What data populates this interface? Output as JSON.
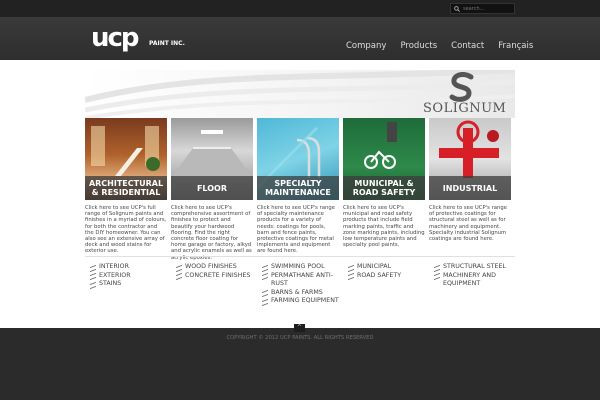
{
  "search": {
    "placeholder": "search..."
  },
  "brand": {
    "mark": "ucp",
    "sub": "PAINT INC."
  },
  "nav": {
    "items": [
      "Company",
      "Products",
      "Contact",
      "Français"
    ]
  },
  "banner": {
    "partner_name": "SOLIGNUM"
  },
  "cards": [
    {
      "label": "ARCHITECTURAL & RESIDENTIAL",
      "desc": "Click here to see UCP's full range of Solignum paints and finishes in a myriad of colours, for both the contractor and the DIY homeowner. You can also see an extensive array of deck and wood stains for exterior use."
    },
    {
      "label": "FLOOR",
      "desc": "Click here to see UCP's comprehensive assortment of finishes to protect and beautify your hardwood flooring. Find the right concrete floor coating for home garage or factory, alkyd and acrylic enamels as well as acrylic epoxies."
    },
    {
      "label": "SPECIALTY MAINTENANCE",
      "desc": "Click here to see UCP's range of specialty maintenance products for a variety of needs: coatings for pools, barn and fence paints, protective coatings for metal implements and equipment are found here."
    },
    {
      "label": "MUNICIPAL & ROAD SAFETY",
      "desc": "Click here to see UCP's municipal and road safety products that include field marking paints, traffic and zone marking paints, including low temperature paints and specialty pool paints."
    },
    {
      "label": "INDUSTRIAL",
      "desc": "Click here to see UCP's range of protective coatings for structural steel as well as for machinery and equipment. Specialty industrial Solignum coatings are found here."
    }
  ],
  "links": [
    [
      "INTERIOR",
      "EXTERIOR",
      "STAINS"
    ],
    [
      "WOOD FINISHES",
      "CONCRETE FINISHES"
    ],
    [
      "SWIMMING POOL",
      "PERMATHANE ANTI-RUST",
      "BARNS & FARMS",
      "FARMING EQUIPMENT"
    ],
    [
      "MUNICIPAL",
      "ROAD SAFETY"
    ],
    [
      "STRUCTURAL STEEL",
      "MACHINERY AND EQUIPMENT"
    ]
  ],
  "footer": {
    "copyright": "COPYRIGHT © 2012 UCP PAINTS. ALL RIGHTS RESERVED",
    "to_top": "^"
  },
  "colors": {
    "header_bg": "#2e2e2e",
    "label_overlay": "#3c3c3c",
    "body_bg": "#ffffff"
  },
  "icons": [
    "search-icon",
    "solignum-s-logo",
    "to-top-arrow-icon",
    "link-arrow-icon"
  ]
}
